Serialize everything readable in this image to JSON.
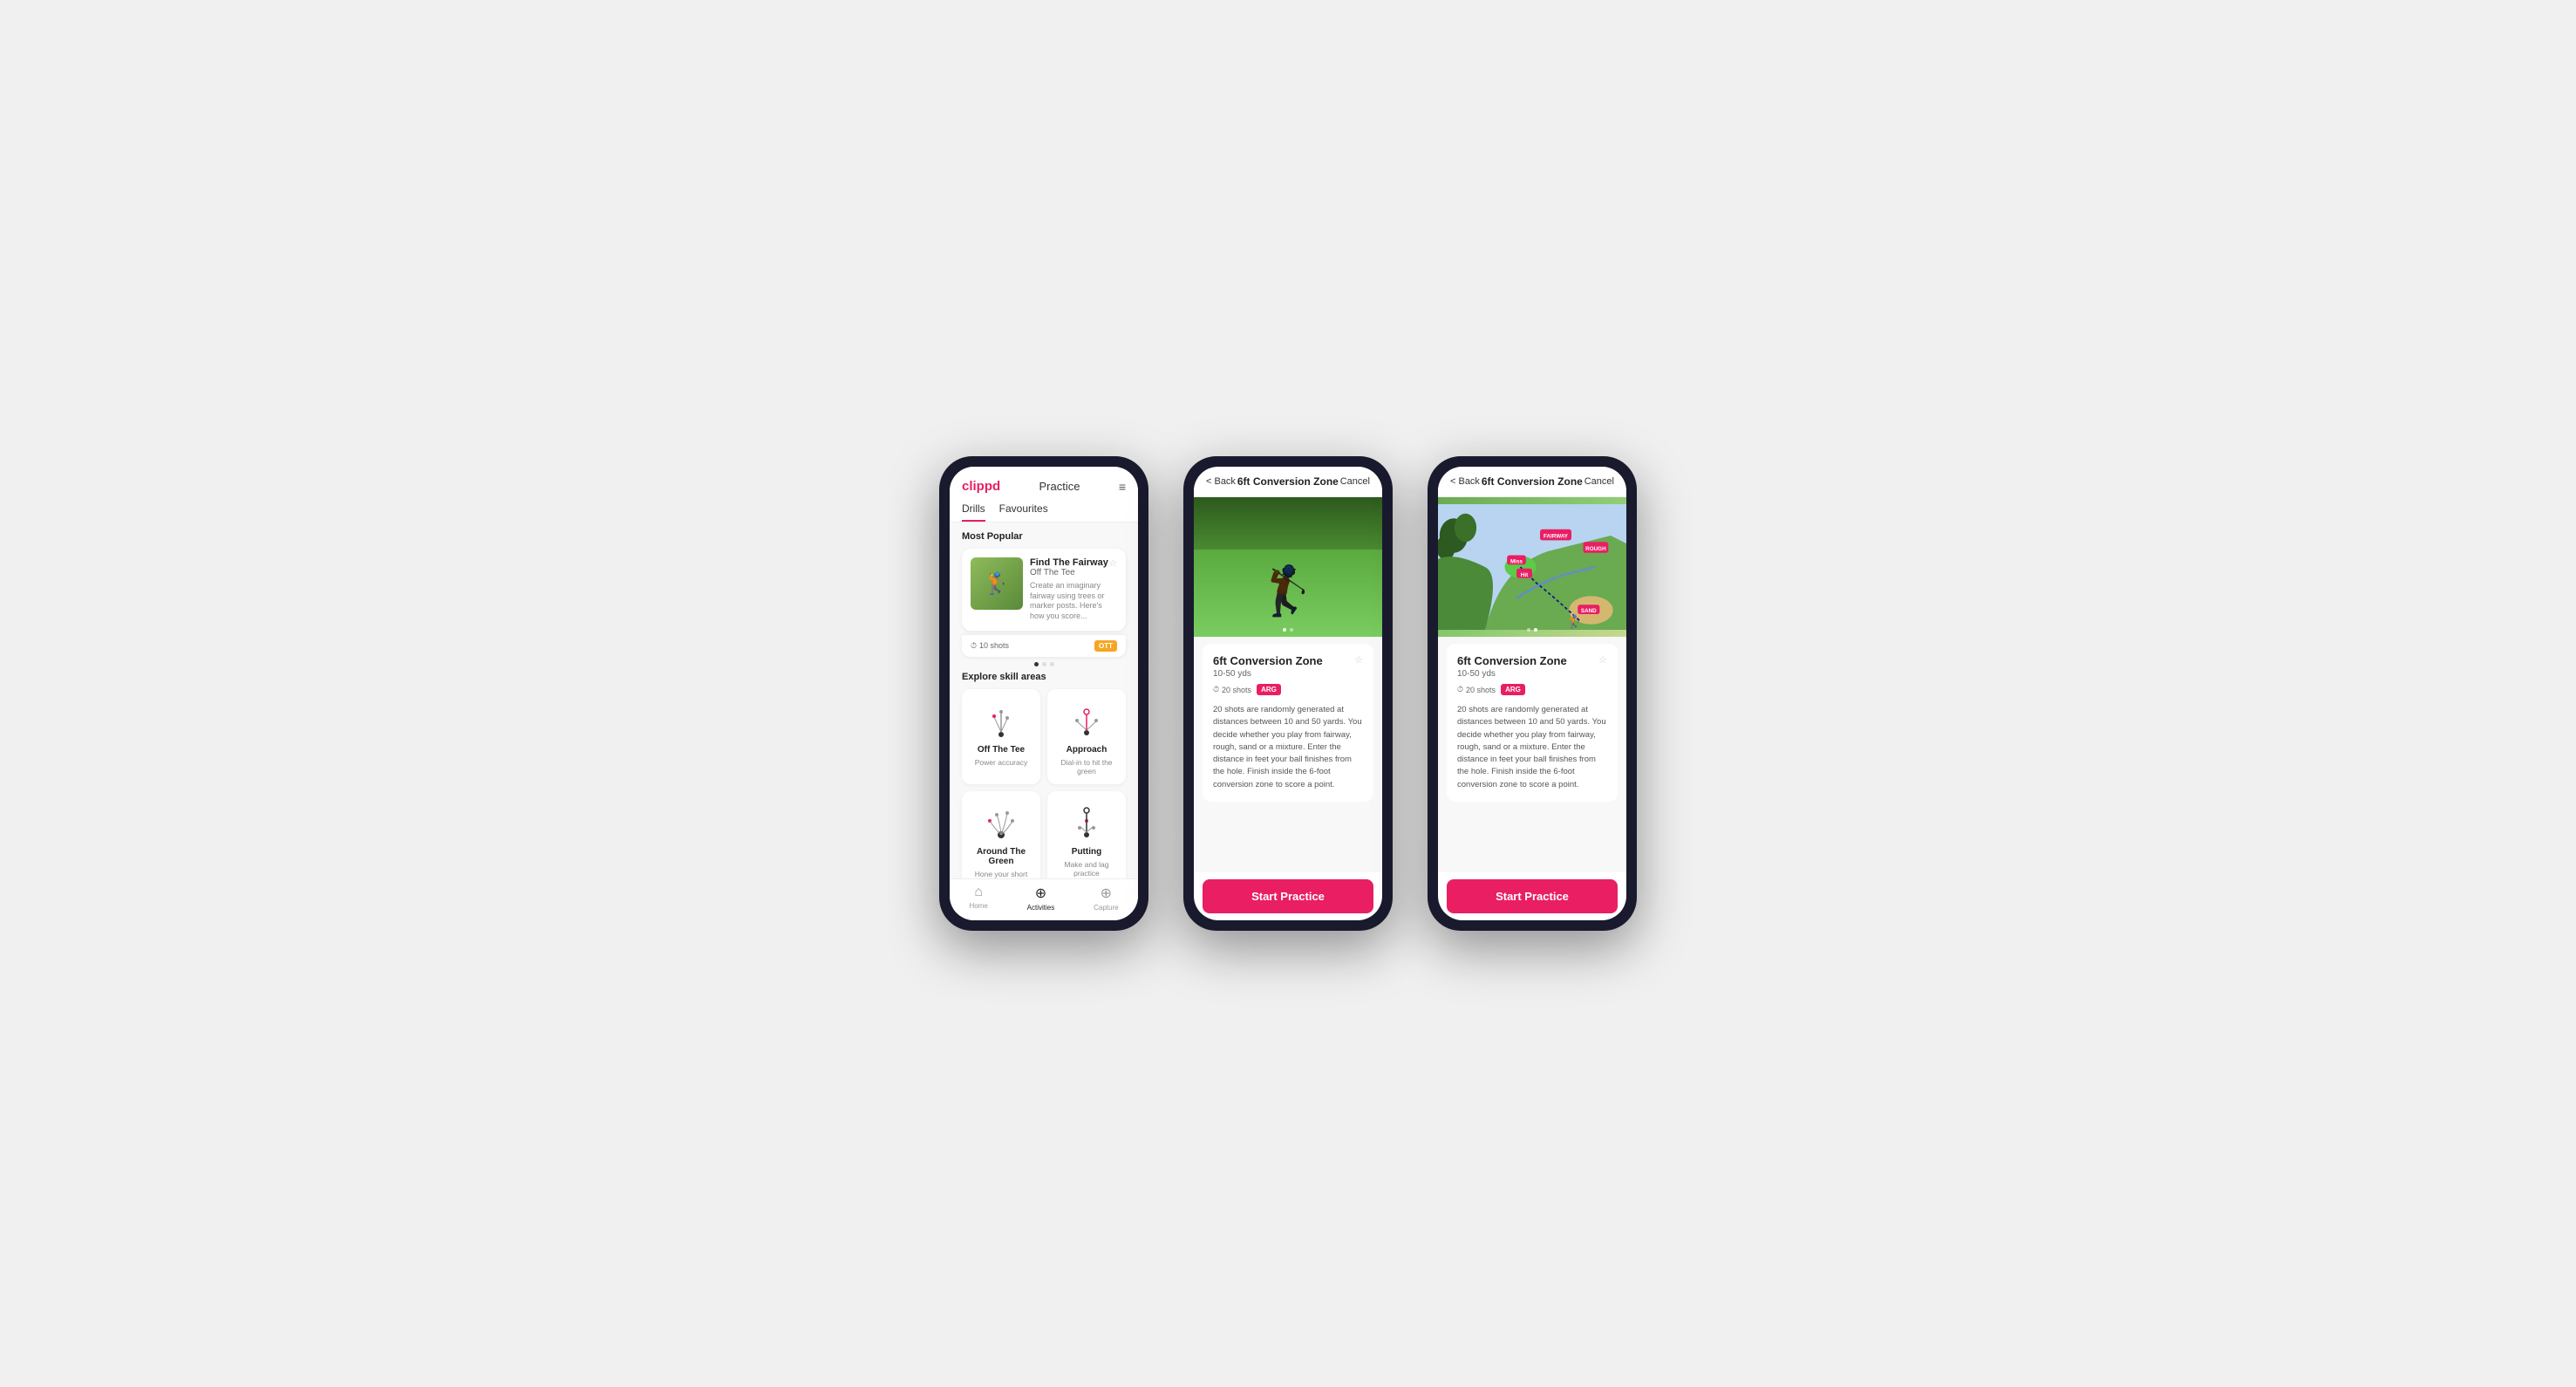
{
  "phone1": {
    "header": {
      "logo": "clippd",
      "title": "Practice",
      "menu_icon": "≡"
    },
    "tabs": [
      {
        "label": "Drills",
        "active": true
      },
      {
        "label": "Favourites",
        "active": false
      }
    ],
    "most_popular": {
      "section_title": "Most Popular",
      "card": {
        "title": "Find The Fairway",
        "subtitle": "Off The Tee",
        "description": "Create an imaginary fairway using trees or marker posts. Here's how you score...",
        "shots": "10 shots",
        "badge": "OTT"
      }
    },
    "explore": {
      "section_title": "Explore skill areas",
      "skills": [
        {
          "name": "Off The Tee",
          "desc": "Power accuracy"
        },
        {
          "name": "Approach",
          "desc": "Dial-in to hit the green"
        },
        {
          "name": "Around The Green",
          "desc": "Hone your short game"
        },
        {
          "name": "Putting",
          "desc": "Make and lag practice"
        }
      ]
    },
    "nav": [
      {
        "label": "Home",
        "icon": "⌂",
        "active": false
      },
      {
        "label": "Activities",
        "icon": "⊕",
        "active": true
      },
      {
        "label": "Capture",
        "icon": "⊕",
        "active": false
      }
    ]
  },
  "phone2": {
    "header": {
      "back": "< Back",
      "title": "6ft Conversion Zone",
      "cancel": "Cancel"
    },
    "drill": {
      "title": "6ft Conversion Zone",
      "range": "10-50 yds",
      "shots": "20 shots",
      "badge": "ARG",
      "description": "20 shots are randomly generated at distances between 10 and 50 yards. You decide whether you play from fairway, rough, sand or a mixture. Enter the distance in feet your ball finishes from the hole. Finish inside the 6-foot conversion zone to score a point."
    },
    "start_button": "Start Practice"
  },
  "phone3": {
    "header": {
      "back": "< Back",
      "title": "6ft Conversion Zone",
      "cancel": "Cancel"
    },
    "drill": {
      "title": "6ft Conversion Zone",
      "range": "10-50 yds",
      "shots": "20 shots",
      "badge": "ARG",
      "description": "20 shots are randomly generated at distances between 10 and 50 yards. You decide whether you play from fairway, rough, sand or a mixture. Enter the distance in feet your ball finishes from the hole. Finish inside the 6-foot conversion zone to score a point."
    },
    "start_button": "Start Practice",
    "map_labels": [
      "Fairway",
      "Rough",
      "Miss",
      "Hit",
      "Sand"
    ]
  }
}
